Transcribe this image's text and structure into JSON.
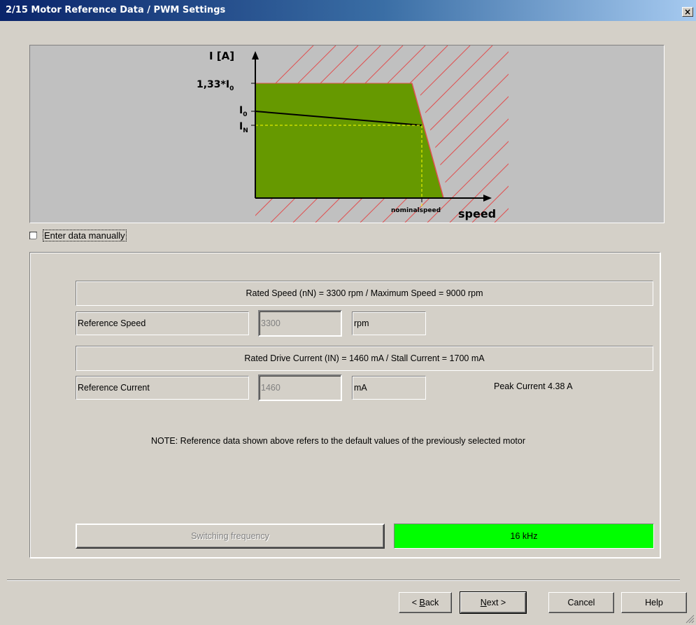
{
  "window": {
    "title": "2/15 Motor Reference Data / PWM Settings",
    "close_glyph": "×"
  },
  "diagram": {
    "y_axis_label": "I [A]",
    "label_peak_prefix": "1,33*I",
    "label_peak_sub": "0",
    "label_i0_main": "I",
    "label_i0_sub": "0",
    "label_in_main": "I",
    "label_in_sub": "N",
    "x_axis_label": "speed",
    "nominal_label": "nominalspeed",
    "colors": {
      "area": "#669900",
      "hatch": "#e05050",
      "background": "#c0c0c0",
      "dashed": "#ffff00"
    }
  },
  "manual": {
    "label": "Enter data manually",
    "checked": false
  },
  "reference": {
    "rated_speed_text": "Rated Speed (nN)  = 3300 rpm / Maximum Speed = 9000 rpm",
    "speed_label": "Reference Speed",
    "speed_value": "3300",
    "speed_unit": "rpm",
    "rated_current_text": "Rated Drive Current (IN)  = 1460 mA / Stall Current = 1700 mA",
    "current_label": "Reference Current",
    "current_value": "1460",
    "current_unit": "mA",
    "peak_current": "Peak Current 4.38 A",
    "note": "NOTE: Reference data shown above refers to the default values of the previously selected motor"
  },
  "pwm": {
    "switching_label": "Switching frequency",
    "frequency_value": "16 kHz",
    "frequency_color": "#00ff00"
  },
  "buttons": {
    "back_prefix": "< ",
    "back_mnemonic": "B",
    "back_rest": "ack",
    "next_mnemonic": "N",
    "next_rest": "ext >",
    "cancel": "Cancel",
    "help": "Help"
  }
}
